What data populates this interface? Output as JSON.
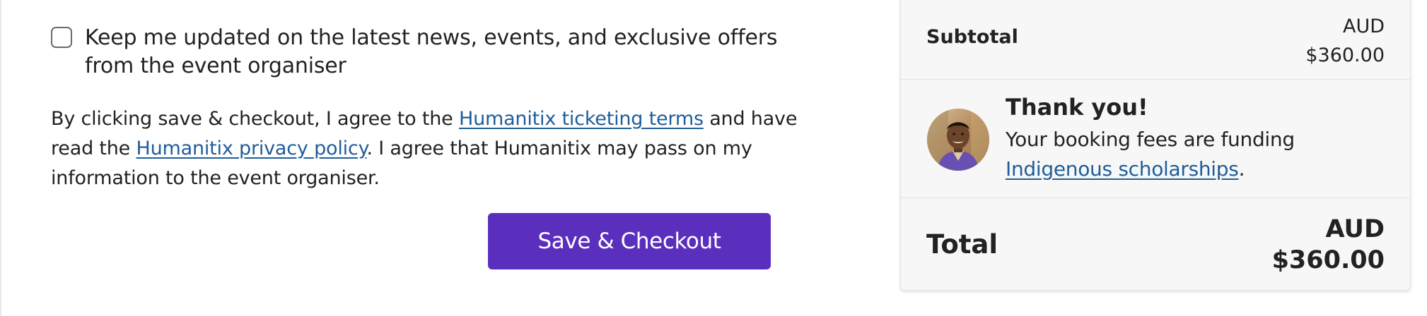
{
  "newsletter": {
    "label": "Keep me updated on the latest news, events, and exclusive offers from the event organiser",
    "checked": false
  },
  "terms": {
    "prefix": "By clicking save & checkout, I agree to the ",
    "ticketing_terms_link": "Humanitix ticketing terms",
    "middle": " and have read the ",
    "privacy_policy_link": "Humanitix privacy policy",
    "suffix": ". I agree that Humanitix may pass on my information to the event organiser."
  },
  "checkout_button": {
    "label": "Save & Checkout"
  },
  "summary": {
    "subtotal": {
      "label": "Subtotal",
      "currency": "AUD",
      "amount": "$360.00"
    },
    "thanks": {
      "title": "Thank you!",
      "text_prefix": "Your booking fees are funding ",
      "link": "Indigenous scholarships",
      "text_suffix": "."
    },
    "total": {
      "label": "Total",
      "currency": "AUD",
      "amount": "$360.00"
    }
  },
  "colors": {
    "accent_button": "#5b2fbd",
    "link": "#1f5d99",
    "panel_bg": "#f7f7f7",
    "text": "#222222"
  },
  "icons": {
    "avatar": "person-portrait-avatar",
    "checkbox": "checkbox-unchecked"
  }
}
